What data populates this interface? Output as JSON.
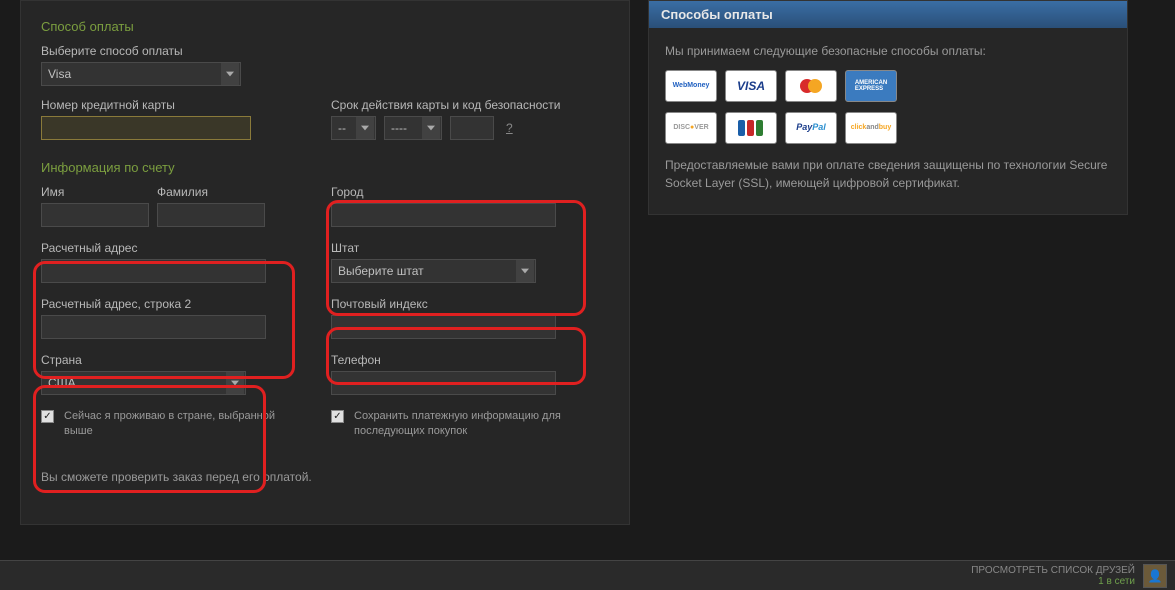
{
  "payment": {
    "section_title": "Способ оплаты",
    "select_label": "Выберите способ оплаты",
    "select_value": "Visa",
    "card_number_label": "Номер кредитной карты",
    "card_number_value": "",
    "expiry_label": "Срок действия карты и код безопасности",
    "month_value": "--",
    "year_value": "----",
    "cvv_value": "",
    "help_symbol": "?"
  },
  "billing": {
    "section_title": "Информация по счету",
    "first_name_label": "Имя",
    "last_name_label": "Фамилия",
    "first_name_value": "",
    "last_name_value": "",
    "city_label": "Город",
    "city_value": "",
    "address_label": "Расчетный адрес",
    "address_value": "",
    "state_label": "Штат",
    "state_value": "Выберите штат",
    "address2_label": "Расчетный адрес, строка 2",
    "address2_value": "",
    "zip_label": "Почтовый индекс",
    "zip_value": "",
    "country_label": "Страна",
    "country_value": "США",
    "phone_label": "Телефон",
    "phone_value": "",
    "residency_checkbox": "Сейчас я проживаю в стране, выбранной выше",
    "save_checkbox": "Сохранить платежную информацию для последующих покупок"
  },
  "footer": {
    "note": "Вы сможете проверить заказ перед его оплатой."
  },
  "sidebar": {
    "header": "Способы оплаты",
    "intro": "Мы принимаем следующие безопасные способы оплаты:",
    "cards_row1": [
      "WebMoney",
      "VISA",
      "MasterCard",
      "AmEx"
    ],
    "cards_row2": [
      "Discover",
      "JCB",
      "PayPal",
      "ClickAndBuy"
    ],
    "security": "Предоставляемые вами при оплате сведения защищены по технологии Secure Socket Layer (SSL), имеющей цифровой сертификат."
  },
  "friends": {
    "title": "ПРОСМОТРЕТЬ СПИСОК ДРУЗЕЙ",
    "status": "1 в сети"
  }
}
